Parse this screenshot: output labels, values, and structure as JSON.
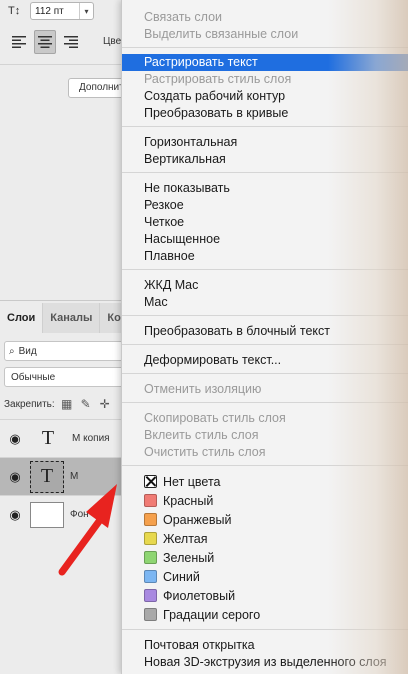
{
  "character_panel": {
    "font_size_value": "112 пт",
    "color_label": "Цвет",
    "extra_button_label": "Дополнительно"
  },
  "layers_panel": {
    "tabs": [
      {
        "label": "Слои"
      },
      {
        "label": "Каналы"
      },
      {
        "label": "Ко"
      }
    ],
    "filter_label": "Вид",
    "blend_mode": "Обычные",
    "lock_label": "Закрепить:",
    "layers": [
      {
        "name": "М копия",
        "kind": "text"
      },
      {
        "name": "М",
        "kind": "text"
      },
      {
        "name": "Фон",
        "kind": "background"
      }
    ]
  },
  "context_menu": {
    "group1": [
      {
        "label": "Связать слои",
        "enabled": false
      },
      {
        "label": "Выделить связанные слои",
        "enabled": false
      }
    ],
    "group2": [
      {
        "label": "Растрировать текст",
        "enabled": true,
        "highlighted": true
      },
      {
        "label": "Растрировать стиль слоя",
        "enabled": false
      },
      {
        "label": "Создать рабочий контур",
        "enabled": true
      },
      {
        "label": "Преобразовать в кривые",
        "enabled": true
      }
    ],
    "group3": [
      {
        "label": "Горизонтальная",
        "enabled": true
      },
      {
        "label": "Вертикальная",
        "enabled": true
      }
    ],
    "group4": [
      {
        "label": "Не показывать",
        "enabled": true
      },
      {
        "label": "Резкое",
        "enabled": true
      },
      {
        "label": "Четкое",
        "enabled": true
      },
      {
        "label": "Насыщенное",
        "enabled": true
      },
      {
        "label": "Плавное",
        "enabled": true
      }
    ],
    "group5": [
      {
        "label": "ЖКД Mac",
        "enabled": true
      },
      {
        "label": "Mac",
        "enabled": true
      }
    ],
    "group6": [
      {
        "label": "Преобразовать в блочный текст",
        "enabled": true
      }
    ],
    "group7": [
      {
        "label": "Деформировать текст...",
        "enabled": true
      }
    ],
    "group8": [
      {
        "label": "Отменить изоляцию",
        "enabled": false
      }
    ],
    "group9": [
      {
        "label": "Скопировать стиль слоя",
        "enabled": false
      },
      {
        "label": "Вклеить стиль слоя",
        "enabled": false
      },
      {
        "label": "Очистить стиль слоя",
        "enabled": false
      }
    ],
    "colors": [
      {
        "label": "Нет цвета",
        "color": "none"
      },
      {
        "label": "Красный",
        "color": "#f07b74"
      },
      {
        "label": "Оранжевый",
        "color": "#f5a04c"
      },
      {
        "label": "Желтая",
        "color": "#e7d84e"
      },
      {
        "label": "Зеленый",
        "color": "#8ed572"
      },
      {
        "label": "Синий",
        "color": "#7cb6f2"
      },
      {
        "label": "Фиолетовый",
        "color": "#a889e0"
      },
      {
        "label": "Градации серого",
        "color": "#a9a9a9"
      }
    ],
    "group11": [
      {
        "label": "Почтовая открытка",
        "enabled": true
      },
      {
        "label": "Новая 3D-экструзия из выделенного слоя",
        "enabled": true
      }
    ]
  },
  "annotation": {
    "arrow_color": "#e8231f"
  }
}
